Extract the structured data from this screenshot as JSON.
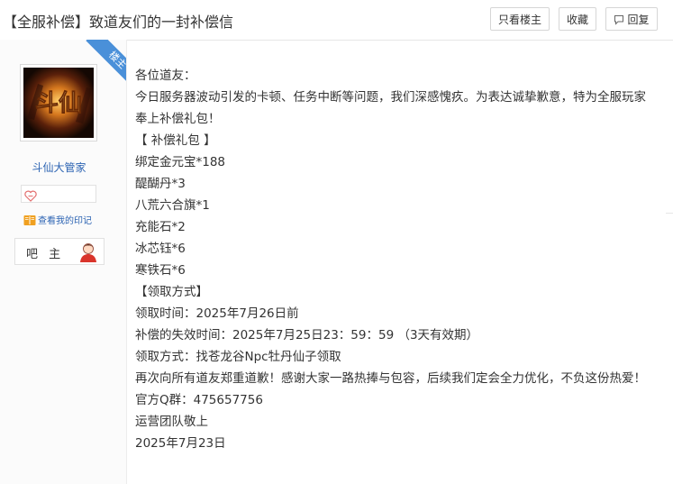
{
  "header": {
    "title": "【全服补偿】致道友们的一封补偿信",
    "only_owner_label": "只看楼主",
    "favorite_label": "收藏",
    "reply_label": "回复"
  },
  "author": {
    "corner_badge": "楼主",
    "avatar_logo_text": "斗仙",
    "username": "斗仙大管家",
    "seal_link": "查看我的印记",
    "role_label": "吧 主"
  },
  "post": {
    "lines": [
      "各位道友：",
      "今日服务器波动引发的卡顿、任务中断等问题，我们深感愧疚。为表达诚挚歉意，特为全服玩家奉上补偿礼包！",
      "【 补偿礼包 】",
      "绑定金元宝*188",
      "醍醐丹*3",
      "八荒六合旗*1",
      "充能石*2",
      "冰芯钰*6",
      "寒铁石*6",
      "【领取方式】",
      "领取时间：2025年7月26日前",
      "补偿的失效时间：2025年7月25日23：59：59 （3天有效期）",
      "领取方式：找苍龙谷Npc牡丹仙子领取",
      "再次向所有道友郑重道歉！感谢大家一路热捧与包容，后续我们定会全力优化，不负这份热爱！",
      "官方Q群：475657756",
      "运营团队敬上",
      "2025年7月23日"
    ]
  },
  "colors": {
    "link": "#2d64b3",
    "ribbon": "#4a90d9",
    "text": "#333333",
    "border": "#d6d6d6"
  },
  "icons": {
    "reply": "speech-bubble-icon",
    "badge": "heart-badge-icon",
    "seal": "book-icon",
    "role": "user-avatar-icon"
  }
}
